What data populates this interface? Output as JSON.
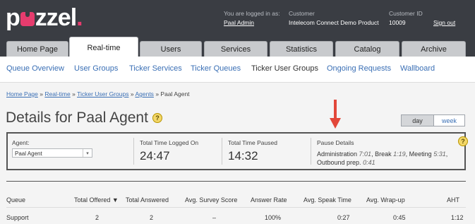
{
  "header": {
    "logged_in_label": "You are logged in as:",
    "user": "Paal Admin",
    "customer_label": "Customer",
    "customer": "Intelecom Connect Demo Product",
    "customer_id_label": "Customer ID",
    "customer_id": "10009",
    "sign_out": "Sign out"
  },
  "tabs": [
    {
      "label": "Home Page"
    },
    {
      "label": "Real-time"
    },
    {
      "label": "Users"
    },
    {
      "label": "Services"
    },
    {
      "label": "Statistics"
    },
    {
      "label": "Catalog"
    },
    {
      "label": "Archive"
    }
  ],
  "subnav": [
    {
      "label": "Queue Overview"
    },
    {
      "label": "User Groups"
    },
    {
      "label": "Ticker Services"
    },
    {
      "label": "Ticker Queues"
    },
    {
      "label": "Ticker User Groups"
    },
    {
      "label": "Ongoing Requests"
    },
    {
      "label": "Wallboard"
    }
  ],
  "breadcrumb": {
    "home": "Home Page",
    "realtime": "Real-time",
    "group": "Ticker User Groups",
    "agents": "Agents",
    "current": "Paal Agent",
    "sep": "»"
  },
  "title": "Details for Paal Agent",
  "range": {
    "day": "day",
    "week": "week"
  },
  "agent": {
    "label": "Agent:",
    "selected": "Paal Agent"
  },
  "stats": {
    "logged_label": "Total Time Logged On",
    "logged_value": "24:47",
    "paused_label": "Total Time Paused",
    "paused_value": "14:32",
    "pause_label": "Pause Details"
  },
  "pause_details": [
    {
      "name": "Administration",
      "time": "7:01"
    },
    {
      "name": "Break",
      "time": "1:19"
    },
    {
      "name": "Meeting",
      "time": "5:31"
    },
    {
      "name": "Outbound prep.",
      "time": "0:41"
    }
  ],
  "table": {
    "headers": [
      "Queue",
      "Total Offered ▼",
      "Total Answered",
      "Avg. Survey Score",
      "Answer Rate",
      "Avg. Speak Time",
      "Avg. Wrap-up",
      "AHT"
    ],
    "rows": [
      [
        "Support",
        "2",
        "2",
        "–",
        "100%",
        "0:27",
        "0:45",
        "1:12"
      ]
    ]
  },
  "colors": {
    "header_bg": "#3a3d43",
    "link": "#3a6fb5",
    "brand": "#e63c6e",
    "arrow": "#e2473a"
  }
}
